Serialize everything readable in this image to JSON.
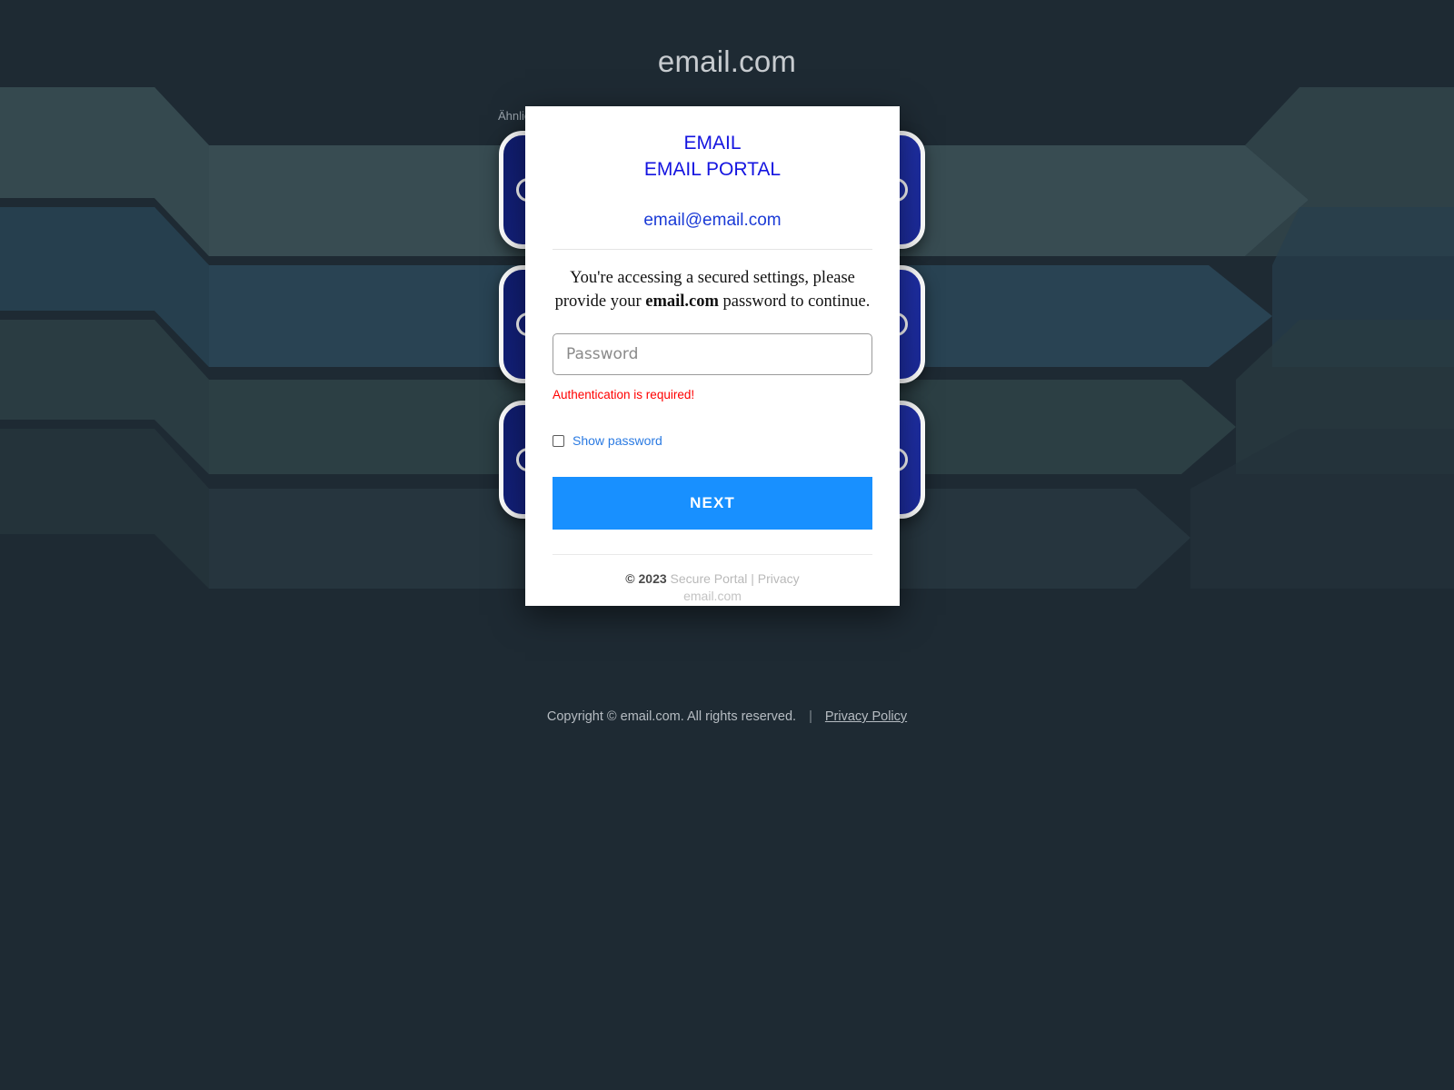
{
  "page": {
    "title": "email.com",
    "background_color": "#1e2a33",
    "behind_text": "Ähnlic"
  },
  "background": {
    "band_colors": [
      "#3a4e54",
      "#2a4455",
      "#2d4046",
      "#27363f"
    ],
    "accent_pill_border": "#ffffff",
    "accent_pill_gradient_from": "#101d6e",
    "accent_pill_gradient_to": "#2436b8"
  },
  "pills": [
    {
      "name": "pill-row-1"
    },
    {
      "name": "pill-row-2"
    },
    {
      "name": "pill-row-3"
    }
  ],
  "modal": {
    "brand_line_1": "EMAIL",
    "brand_line_2": "EMAIL PORTAL",
    "brand_color": "#1414e0",
    "account_email": "email@email.com",
    "instruction_prefix": "You're accessing a secured settings, please provide your ",
    "instruction_bold": "email.com",
    "instruction_suffix": " password to continue.",
    "password_placeholder": "Password",
    "password_value": "",
    "error_message": "Authentication is required!",
    "error_color": "#ff0000",
    "show_password_label": "Show password",
    "show_password_checked": false,
    "next_button_label": "NEXT",
    "next_button_color": "#1890ff",
    "footer_copyright": "© 2023 ",
    "footer_links": "Secure Portal | Privacy",
    "footer_domain": "email.com"
  },
  "footer": {
    "copyright": "Copyright © email.com.  All rights reserved.",
    "separator": "|",
    "privacy_link": "Privacy Policy"
  }
}
